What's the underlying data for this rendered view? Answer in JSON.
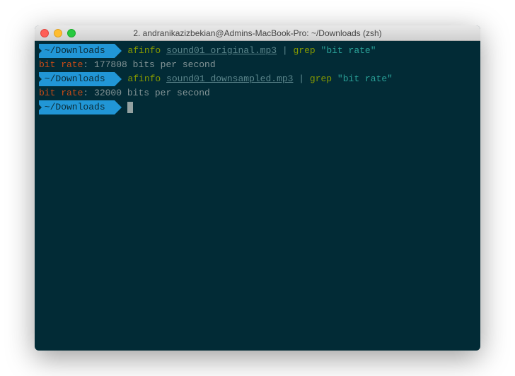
{
  "window": {
    "title": "2. andranikazizbekian@Admins-MacBook-Pro: ~/Downloads (zsh)"
  },
  "prompt": {
    "path": " ~/Downloads "
  },
  "commands": {
    "cmd1": {
      "prog": "afinfo",
      "arg": "sound01_original.mp3",
      "pipe": " | ",
      "grep": "grep",
      "pattern": "\"bit rate\""
    },
    "cmd2": {
      "prog": "afinfo",
      "arg": "sound01_downsampled.mp3",
      "pipe": " | ",
      "grep": "grep",
      "pattern": "\"bit rate\""
    }
  },
  "outputs": {
    "out1": {
      "key": "bit rate",
      "colon": ": ",
      "value": "177808 bits per second"
    },
    "out2": {
      "key": "bit rate",
      "colon": ": ",
      "value": "32000 bits per second"
    }
  }
}
